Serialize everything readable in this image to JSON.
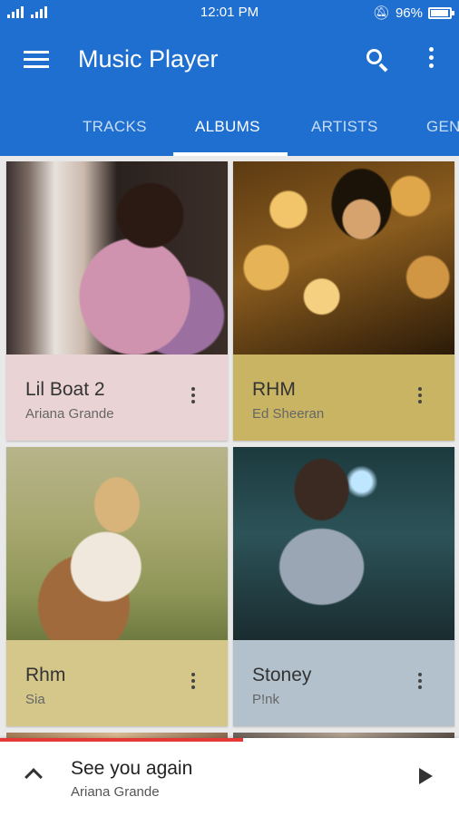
{
  "status_bar": {
    "time": "12:01 PM",
    "battery": "96%",
    "battery_level": 0.96
  },
  "app_bar": {
    "title": "Music Player",
    "icons": [
      "menu-icon",
      "search-icon",
      "more-vert-icon"
    ]
  },
  "tabs": [
    {
      "label": "TRACKS",
      "active": false
    },
    {
      "label": "ALBUMS",
      "active": true
    },
    {
      "label": "ARTISTS",
      "active": false
    },
    {
      "label": "GEN",
      "active": false
    }
  ],
  "albums": [
    {
      "name": "Lil Boat 2",
      "artist": "Ariana Grande",
      "color": "#ead3d5"
    },
    {
      "name": "RHM",
      "artist": "Ed Sheeran",
      "color": "#c8b462"
    },
    {
      "name": "Rhm",
      "artist": "Sia",
      "color": "#d5c78a"
    },
    {
      "name": "Stoney",
      "artist": "P!nk",
      "color": "#b2c1cb"
    }
  ],
  "now_playing": {
    "title": "See you again",
    "artist": "Ariana Grande",
    "progress": 0.53
  },
  "colors": {
    "primary": "#1f6fd1",
    "accent": "#e53935"
  }
}
